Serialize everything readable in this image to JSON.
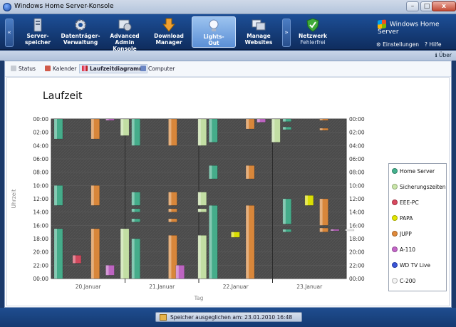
{
  "window": {
    "title": "Windows Home Server-Konsole",
    "min": "–",
    "max": "□",
    "close": "x"
  },
  "nav": {
    "left_arrow": "«",
    "right_arrow": "»",
    "tiles": [
      {
        "line1": "Server-",
        "line2": "speicher"
      },
      {
        "line1": "Datenträger-",
        "line2": "Verwaltung"
      },
      {
        "line1": "Advanced",
        "line2": "Admin Konsole"
      },
      {
        "line1": "Download",
        "line2": "Manager"
      },
      {
        "line1": "Lights-",
        "line2": "Out"
      },
      {
        "line1": "Manage",
        "line2": "Websites"
      },
      {
        "line1": "Netzwerk",
        "line2": "Fehlerfrei"
      }
    ],
    "brand": "Windows Home Server",
    "settings": "Einstellungen",
    "help": "Hilfe",
    "about": "Über"
  },
  "subtabs": [
    "Status",
    "Kalender",
    "Laufzeitdiagramm",
    "Computer"
  ],
  "chart_data": {
    "type": "bar",
    "title": "Laufzeit",
    "ylabel": "Uhrzeit",
    "xlabel": "Tag",
    "y_ticks": [
      "00:00",
      "02:00",
      "04:00",
      "06:00",
      "08:00",
      "10:00",
      "12:00",
      "14:00",
      "16:00",
      "18:00",
      "20:00",
      "22:00",
      "00:00"
    ],
    "x_ticks": [
      "20.Januar",
      "21.Januar",
      "22.Januar",
      "23.Januar"
    ],
    "legend_position": "right",
    "series": [
      {
        "name": "Home Server",
        "color": "#45b28e"
      },
      {
        "name": "Sicherungszeiten",
        "color": "#c9e6a8"
      },
      {
        "name": "EEE-PC",
        "color": "#d8485e"
      },
      {
        "name": "PAPA",
        "color": "#e2e600"
      },
      {
        "name": "JUPP",
        "color": "#e08a3a"
      },
      {
        "name": "A-110",
        "color": "#c466c8"
      },
      {
        "name": "WD TV Live",
        "color": "#3a55d8"
      },
      {
        "name": "C-200",
        "color": "#f4f4f4"
      }
    ],
    "segments": [
      {
        "series": 0,
        "day": 0,
        "start": 0,
        "end": 3
      },
      {
        "series": 0,
        "day": 0,
        "start": 10,
        "end": 13
      },
      {
        "series": 0,
        "day": 0,
        "start": 16.5,
        "end": 24
      },
      {
        "series": 4,
        "day": 0.5,
        "start": 0,
        "end": 3
      },
      {
        "series": 4,
        "day": 0.5,
        "start": 10,
        "end": 13
      },
      {
        "series": 4,
        "day": 0.5,
        "start": 16.5,
        "end": 24
      },
      {
        "series": 2,
        "day": 0.25,
        "start": 20.5,
        "end": 21.7
      },
      {
        "series": 5,
        "day": 0.7,
        "start": 22,
        "end": 23.5
      },
      {
        "series": 5,
        "day": 0.7,
        "start": 0,
        "end": 0.2
      },
      {
        "series": 1,
        "day": 0.9,
        "start": 0,
        "end": 2.5
      },
      {
        "series": 1,
        "day": 0.9,
        "start": 16.5,
        "end": 24
      },
      {
        "series": 0,
        "day": 1.05,
        "start": 0,
        "end": 4
      },
      {
        "series": 0,
        "day": 1.05,
        "start": 11,
        "end": 13
      },
      {
        "series": 0,
        "day": 1.05,
        "start": 13.5,
        "end": 14
      },
      {
        "series": 0,
        "day": 1.05,
        "start": 15,
        "end": 15.5
      },
      {
        "series": 0,
        "day": 1.05,
        "start": 18,
        "end": 24
      },
      {
        "series": 4,
        "day": 1.55,
        "start": 0,
        "end": 4
      },
      {
        "series": 4,
        "day": 1.55,
        "start": 11,
        "end": 13
      },
      {
        "series": 4,
        "day": 1.55,
        "start": 13.5,
        "end": 14
      },
      {
        "series": 4,
        "day": 1.55,
        "start": 15,
        "end": 15.5
      },
      {
        "series": 4,
        "day": 1.55,
        "start": 17.5,
        "end": 24
      },
      {
        "series": 5,
        "day": 1.65,
        "start": 22,
        "end": 24
      },
      {
        "series": 1,
        "day": 1.95,
        "start": 0,
        "end": 4
      },
      {
        "series": 1,
        "day": 1.95,
        "start": 11,
        "end": 13
      },
      {
        "series": 1,
        "day": 1.95,
        "start": 13.5,
        "end": 14
      },
      {
        "series": 1,
        "day": 1.95,
        "start": 17.5,
        "end": 24
      },
      {
        "series": 0,
        "day": 2.1,
        "start": 0,
        "end": 3.5
      },
      {
        "series": 0,
        "day": 2.1,
        "start": 7,
        "end": 9
      },
      {
        "series": 0,
        "day": 2.1,
        "start": 13,
        "end": 24
      },
      {
        "series": 3,
        "day": 2.4,
        "start": 17,
        "end": 17.8
      },
      {
        "series": 4,
        "day": 2.6,
        "start": 0,
        "end": 1.5
      },
      {
        "series": 4,
        "day": 2.6,
        "start": 7,
        "end": 9
      },
      {
        "series": 4,
        "day": 2.6,
        "start": 13,
        "end": 24
      },
      {
        "series": 5,
        "day": 2.75,
        "start": 0,
        "end": 0.5
      },
      {
        "series": 1,
        "day": 2.95,
        "start": 0,
        "end": 3.5
      },
      {
        "series": 0,
        "day": 3.1,
        "start": 0,
        "end": 0.4
      },
      {
        "series": 0,
        "day": 3.1,
        "start": 1.2,
        "end": 1.6
      },
      {
        "series": 0,
        "day": 3.1,
        "start": 12,
        "end": 15.8
      },
      {
        "series": 0,
        "day": 3.1,
        "start": 16.6,
        "end": 17
      },
      {
        "series": 3,
        "day": 3.4,
        "start": 11.5,
        "end": 13
      },
      {
        "series": 4,
        "day": 3.6,
        "start": 0,
        "end": 0.2
      },
      {
        "series": 4,
        "day": 3.6,
        "start": 1.4,
        "end": 1.7
      },
      {
        "series": 4,
        "day": 3.6,
        "start": 12,
        "end": 16
      },
      {
        "series": 4,
        "day": 3.6,
        "start": 16.4,
        "end": 17
      },
      {
        "series": 5,
        "day": 3.75,
        "start": 16.6,
        "end": 16.8
      },
      {
        "series": 7,
        "day": 3.95,
        "start": 16.6,
        "end": 16.8
      }
    ]
  },
  "status": {
    "text": "Speicher ausgeglichen am: 23.01.2010 16:48"
  }
}
